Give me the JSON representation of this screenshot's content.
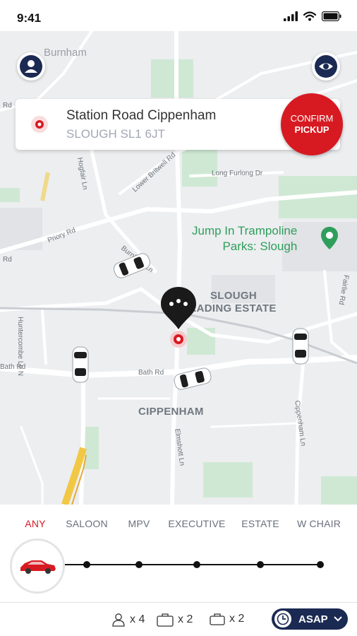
{
  "status_bar": {
    "time": "9:41"
  },
  "map": {
    "town_label": "Burnham",
    "road_labels": {
      "rd_top_left": "Rd",
      "hogfair_ln": "Hogfair Ln",
      "lower_britwell_rd": "Lower Britwell Rd",
      "long_furlong_dr": "Long Furlong Dr",
      "priory_rd": "Priory Rd",
      "rd_mid_left": "Rd",
      "burnham_ln": "Burnham Ln",
      "huntercombe_ln_n": "Huntercombe Ln N",
      "bath_rd_left": "Bath Rd",
      "bath_rd_mid": "Bath Rd",
      "fairlie_rd": "Fairlie Rd",
      "cippenham_ln": "Cippenham Ln",
      "elmshott_ln": "Elmshott Ln"
    },
    "poi": {
      "line1": "Jump In Trampoline",
      "line2": "Parks: Slough"
    },
    "area_labels": {
      "slough_line1": "SLOUGH",
      "slough_line2": "TRADING ESTATE",
      "cippenham": "CIPPENHAM"
    }
  },
  "buttons": {
    "profile_icon": "person-icon",
    "view_icon": "eye-icon"
  },
  "pickup": {
    "line1": "Station Road Cippenham",
    "line2": "SLOUGH SL1 6JT",
    "confirm_line1": "CONFIRM",
    "confirm_line2": "PICKUP"
  },
  "car_types": {
    "tabs": [
      "ANY",
      "SALOON",
      "MPV",
      "EXECUTIVE",
      "ESTATE",
      "W CHAIR"
    ],
    "selected": "ANY"
  },
  "capacity": {
    "passengers": "x 4",
    "large_luggage": "x 2",
    "small_luggage": "x 2"
  },
  "schedule": {
    "label": "ASAP"
  },
  "colors": {
    "accent": "#d71a21",
    "navy": "#1b2a52",
    "poi_green": "#2f9e5b"
  }
}
